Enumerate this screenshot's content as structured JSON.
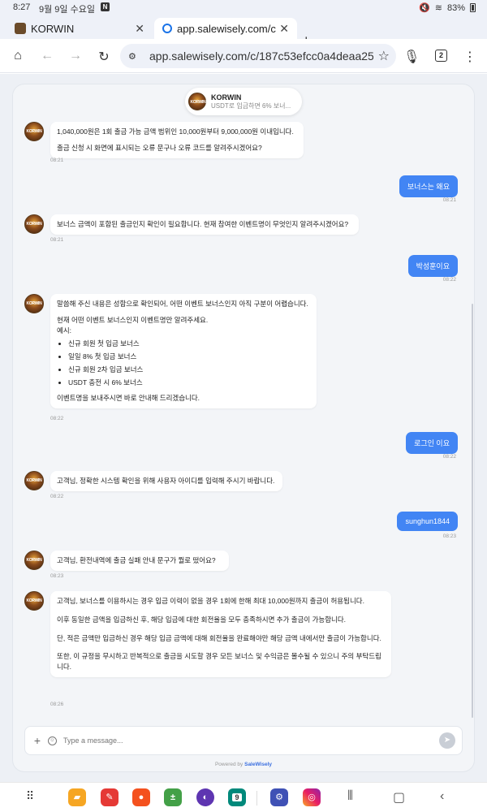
{
  "status_bar": {
    "time": "8:27",
    "date": "9월 9일 수요일",
    "notif_badge": "N",
    "battery": "83%"
  },
  "tabs": [
    {
      "label": "KORWIN",
      "active": false
    },
    {
      "label": "app.salewisely.com/c/187c",
      "active": true
    }
  ],
  "toolbar": {
    "url": "app.salewisely.com/c/187c53efcc0a4deaa257",
    "tab_count": "2"
  },
  "chat_header": {
    "name": "KORWIN",
    "subtitle": "USDT로 입금하면 6% 보너..."
  },
  "messages": [
    {
      "from": "bot",
      "paragraphs": [
        "1,040,000원은 1회 출금 가능 금액 범위인 10,000원부터 9,000,000원 이내입니다.",
        "출금 신청 시 화면에 표시되는 오류 문구나 오류 코드를 알려주시겠어요?"
      ],
      "time": "08:21"
    },
    {
      "from": "user",
      "text": "보너스는 왜요",
      "time": "08:21"
    },
    {
      "from": "bot",
      "paragraphs": [
        "보너스 금액이 포함된 출금인지 확인이 필요합니다. 현재 참여한 이벤트명이 무엇인지 알려주시겠어요?"
      ],
      "time": "08:21"
    },
    {
      "from": "user",
      "text": "박성훈이요",
      "time": "08:22"
    },
    {
      "from": "bot",
      "paragraphs": [
        "말씀해 주신 내용은 성함으로 확인되어, 어떤 이벤트 보너스인지 아직 구분이 어렵습니다.",
        "현재 어떤 이벤트 보너스인지 이벤트명만 알려주세요.",
        "예시:"
      ],
      "list": [
        "신규 회원 첫 입금 보너스",
        "일일 8% 첫 입금 보너스",
        "신규 회원 2차 입금 보너스",
        "USDT 충전 시 6% 보너스"
      ],
      "closing": "이벤트명을 보내주시면 바로 안내해 드리겠습니다.",
      "time": "08:22"
    },
    {
      "from": "user",
      "text": "로그인 이요",
      "time": "08:22"
    },
    {
      "from": "bot",
      "paragraphs": [
        "고객님, 정확한 시스템 확인을 위해 사용자 아이디를 입력해 주시기 바랍니다."
      ],
      "time": "08:22"
    },
    {
      "from": "user",
      "text": "sunghun1844",
      "time": "08:23"
    },
    {
      "from": "bot",
      "paragraphs": [
        "고객님, 환전내역에 출금 실패 안내 문구가 뭘로 떴어요?"
      ],
      "time": "08:23"
    },
    {
      "from": "bot",
      "paragraphs": [
        "고객님, 보너스를 이용하시는 경우 입금 이력이 없을 경우 1회에 한해 최대 10,000원까지 출금이 허용됩니다.",
        "이후 동일한 금액을 입금하신 후, 해당 입금에 대한 회전율을 모두 충족하시면 추가 출금이 가능합니다.",
        "단, 적은 금액만 입금하신 경우 해당 입금 금액에 대해 회전율을 완료해야만 해당 금액 내에서만 출금이 가능합니다.",
        "또한, 이 규정을 무시하고 반복적으로 출금을 시도할 경우 모든 보너스 및 수익금은 몰수될 수 있으니 주의 부탁드립니다."
      ],
      "time": "08:26"
    }
  ],
  "composer": {
    "placeholder": "Type a message..."
  },
  "powered_by": {
    "prefix": "Powered by",
    "brand": "SaleWisely"
  },
  "nav_apps": [
    "grid-icon",
    "files-app",
    "notes-app",
    "contacts-app",
    "calculator-app",
    "internet-app",
    "calendar-app",
    "settings-app",
    "instagram-app"
  ],
  "calendar_day": "9",
  "colors": {
    "accent": "#4285f4",
    "user_bubble": "#4285f4",
    "page_bg": "#edf0f5",
    "chat_bg": "#f3f5f8"
  }
}
